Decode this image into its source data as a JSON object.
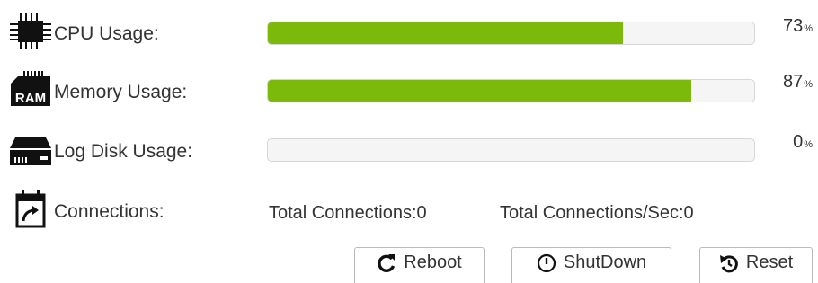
{
  "metrics": [
    {
      "label": "CPU Usage:",
      "percent": 73,
      "percent_text": "73",
      "unit": "%",
      "icon": "cpu-chip-icon"
    },
    {
      "label": "Memory Usage:",
      "percent": 87,
      "percent_text": "87",
      "unit": "%",
      "icon": "ram-icon",
      "icon_text": "RAM"
    },
    {
      "label": "Log Disk Usage:",
      "percent": 0,
      "percent_text": "0",
      "unit": "%",
      "icon": "hard-disk-icon"
    }
  ],
  "connections": {
    "label": "Connections:",
    "icon": "calendar-refresh-icon",
    "total": "Total Connections:0",
    "per_sec": "Total Connections/Sec:0"
  },
  "buttons": {
    "reboot": "Reboot",
    "shutdown": "ShutDown",
    "reset": "Reset"
  },
  "colors": {
    "bar_fill": "#7bba0a",
    "bar_track": "#f5f5f5"
  }
}
